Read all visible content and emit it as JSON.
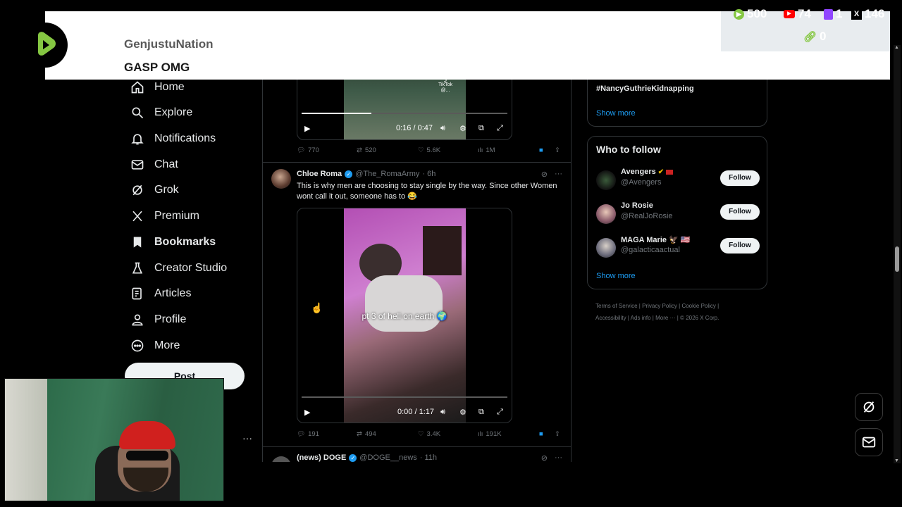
{
  "nav": {
    "items": [
      {
        "label": "Home",
        "icon": "home-icon"
      },
      {
        "label": "Explore",
        "icon": "search-icon"
      },
      {
        "label": "Notifications",
        "icon": "bell-icon"
      },
      {
        "label": "Chat",
        "icon": "mail-icon"
      },
      {
        "label": "Grok",
        "icon": "grok-icon"
      },
      {
        "label": "Premium",
        "icon": "x-logo-icon"
      },
      {
        "label": "Bookmarks",
        "icon": "bookmark-icon"
      },
      {
        "label": "Creator Studio",
        "icon": "flask-icon"
      },
      {
        "label": "Articles",
        "icon": "article-icon"
      },
      {
        "label": "Profile",
        "icon": "person-icon"
      },
      {
        "label": "More",
        "icon": "more-circle-icon"
      }
    ],
    "post_label": "Post",
    "more_dots": "···"
  },
  "timeline": {
    "top_video": {
      "time": "0:16 / 0:47",
      "progress": 0.34,
      "watermark_brand": "TikTok",
      "watermark_handle": "@...",
      "actions": {
        "replies": "770",
        "reposts": "520",
        "likes": "5.6K",
        "views": "1M"
      }
    },
    "tweet": {
      "name": "Chloe Roma",
      "handle": "@The_RomaArmy",
      "time": "· 6h",
      "text": "This is why men are choosing to stay single by the way. Since other Women wont call it out, someone has to 😂",
      "video_caption": "pt 3 of hell on earth 🌍",
      "video_time": "0:00 / 1:17",
      "progress": 0.0,
      "actions": {
        "replies": "191",
        "reposts": "494",
        "likes": "3.4K",
        "views": "191K"
      }
    },
    "next_tweet": {
      "name": "(news) DOGE",
      "handle": "@DOGE__news",
      "time": "· 11h"
    }
  },
  "trends": {
    "partial_trend": "...",
    "trend": "#NancyGuthrieKidnapping",
    "show_more": "Show more"
  },
  "who_to_follow": {
    "title": "Who to follow",
    "accounts": [
      {
        "name": "Avengers",
        "handle": "@Avengers",
        "badge": "🟡 🟥",
        "follow": "Follow"
      },
      {
        "name": "Jo Rosie",
        "handle": "@RealJoRosie",
        "badge": "",
        "follow": "Follow"
      },
      {
        "name": "MAGA Marie 🦅 🇺🇸",
        "handle": "@galacticaactual",
        "badge": "",
        "follow": "Follow"
      }
    ],
    "show_more": "Show more"
  },
  "footer": {
    "links": [
      "Terms of Service",
      "Privacy Policy",
      "Cookie Policy",
      "Accessibility",
      "Ads info",
      "More ···",
      "© 2026 X Corp."
    ]
  },
  "banner": {
    "username": "GenjustuNation",
    "message": "GASP OMG"
  },
  "stats": {
    "rumble": "500",
    "youtube": "74",
    "twitch": "1",
    "x": "146",
    "link": "0"
  },
  "colors": {
    "accent_blue": "#1d9bf0",
    "rumble_green": "#85c742",
    "youtube_red": "#ff0000",
    "twitch_purple": "#9146ff",
    "link_green": "#85c742"
  }
}
